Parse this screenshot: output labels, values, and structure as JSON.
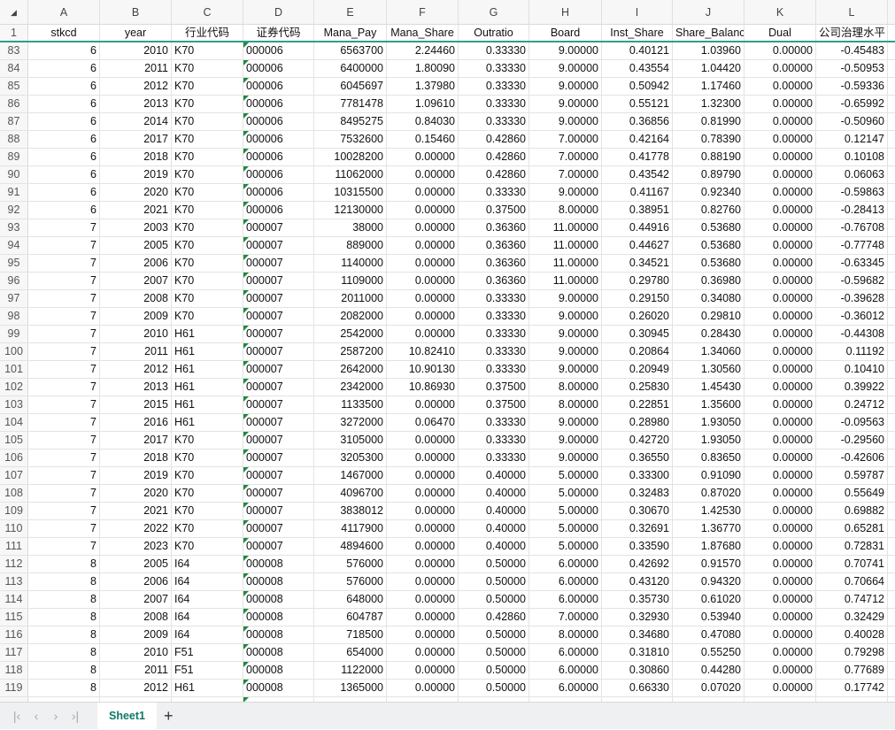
{
  "column_letters": [
    "A",
    "B",
    "C",
    "D",
    "E",
    "F",
    "G",
    "H",
    "I",
    "J",
    "K",
    "L"
  ],
  "corner_icon": "select-all-triangle",
  "header_row_number": "1",
  "headers": [
    "stkcd",
    "year",
    "行业代码",
    "证券代码",
    "Mana_Pay",
    "Mana_Share",
    "Outratio",
    "Board",
    "Inst_Share",
    "Share_Balance",
    "Dual",
    "公司治理水平"
  ],
  "rows": [
    [
      "83",
      "6",
      "2010",
      "K70",
      "000006",
      "6563700",
      "2.24460",
      "0.33330",
      "9.00000",
      "0.40121",
      "1.03960",
      "0.00000",
      "-0.45483"
    ],
    [
      "84",
      "6",
      "2011",
      "K70",
      "000006",
      "6400000",
      "1.80090",
      "0.33330",
      "9.00000",
      "0.43554",
      "1.04420",
      "0.00000",
      "-0.50953"
    ],
    [
      "85",
      "6",
      "2012",
      "K70",
      "000006",
      "6045697",
      "1.37980",
      "0.33330",
      "9.00000",
      "0.50942",
      "1.17460",
      "0.00000",
      "-0.59336"
    ],
    [
      "86",
      "6",
      "2013",
      "K70",
      "000006",
      "7781478",
      "1.09610",
      "0.33330",
      "9.00000",
      "0.55121",
      "1.32300",
      "0.00000",
      "-0.65992"
    ],
    [
      "87",
      "6",
      "2014",
      "K70",
      "000006",
      "8495275",
      "0.84030",
      "0.33330",
      "9.00000",
      "0.36856",
      "0.81990",
      "0.00000",
      "-0.50960"
    ],
    [
      "88",
      "6",
      "2017",
      "K70",
      "000006",
      "7532600",
      "0.15460",
      "0.42860",
      "7.00000",
      "0.42164",
      "0.78390",
      "0.00000",
      "0.12147"
    ],
    [
      "89",
      "6",
      "2018",
      "K70",
      "000006",
      "10028200",
      "0.00000",
      "0.42860",
      "7.00000",
      "0.41778",
      "0.88190",
      "0.00000",
      "0.10108"
    ],
    [
      "90",
      "6",
      "2019",
      "K70",
      "000006",
      "11062000",
      "0.00000",
      "0.42860",
      "7.00000",
      "0.43542",
      "0.89790",
      "0.00000",
      "0.06063"
    ],
    [
      "91",
      "6",
      "2020",
      "K70",
      "000006",
      "10315500",
      "0.00000",
      "0.33330",
      "9.00000",
      "0.41167",
      "0.92340",
      "0.00000",
      "-0.59863"
    ],
    [
      "92",
      "6",
      "2021",
      "K70",
      "000006",
      "12130000",
      "0.00000",
      "0.37500",
      "8.00000",
      "0.38951",
      "0.82760",
      "0.00000",
      "-0.28413"
    ],
    [
      "93",
      "7",
      "2003",
      "K70",
      "000007",
      "38000",
      "0.00000",
      "0.36360",
      "11.00000",
      "0.44916",
      "0.53680",
      "0.00000",
      "-0.76708"
    ],
    [
      "94",
      "7",
      "2005",
      "K70",
      "000007",
      "889000",
      "0.00000",
      "0.36360",
      "11.00000",
      "0.44627",
      "0.53680",
      "0.00000",
      "-0.77748"
    ],
    [
      "95",
      "7",
      "2006",
      "K70",
      "000007",
      "1140000",
      "0.00000",
      "0.36360",
      "11.00000",
      "0.34521",
      "0.53680",
      "0.00000",
      "-0.63345"
    ],
    [
      "96",
      "7",
      "2007",
      "K70",
      "000007",
      "1109000",
      "0.00000",
      "0.36360",
      "11.00000",
      "0.29780",
      "0.36980",
      "0.00000",
      "-0.59682"
    ],
    [
      "97",
      "7",
      "2008",
      "K70",
      "000007",
      "2011000",
      "0.00000",
      "0.33330",
      "9.00000",
      "0.29150",
      "0.34080",
      "0.00000",
      "-0.39628"
    ],
    [
      "98",
      "7",
      "2009",
      "K70",
      "000007",
      "2082000",
      "0.00000",
      "0.33330",
      "9.00000",
      "0.26020",
      "0.29810",
      "0.00000",
      "-0.36012"
    ],
    [
      "99",
      "7",
      "2010",
      "H61",
      "000007",
      "2542000",
      "0.00000",
      "0.33330",
      "9.00000",
      "0.30945",
      "0.28430",
      "0.00000",
      "-0.44308"
    ],
    [
      "100",
      "7",
      "2011",
      "H61",
      "000007",
      "2587200",
      "10.82410",
      "0.33330",
      "9.00000",
      "0.20864",
      "1.34060",
      "0.00000",
      "0.11192"
    ],
    [
      "101",
      "7",
      "2012",
      "H61",
      "000007",
      "2642000",
      "10.90130",
      "0.33330",
      "9.00000",
      "0.20949",
      "1.30560",
      "0.00000",
      "0.10410"
    ],
    [
      "102",
      "7",
      "2013",
      "H61",
      "000007",
      "2342000",
      "10.86930",
      "0.37500",
      "8.00000",
      "0.25830",
      "1.45430",
      "0.00000",
      "0.39922"
    ],
    [
      "103",
      "7",
      "2015",
      "H61",
      "000007",
      "1133500",
      "0.00000",
      "0.37500",
      "8.00000",
      "0.22851",
      "1.35600",
      "0.00000",
      "0.24712"
    ],
    [
      "104",
      "7",
      "2016",
      "H61",
      "000007",
      "3272000",
      "0.06470",
      "0.33330",
      "9.00000",
      "0.28980",
      "1.93050",
      "0.00000",
      "-0.09563"
    ],
    [
      "105",
      "7",
      "2017",
      "K70",
      "000007",
      "3105000",
      "0.00000",
      "0.33330",
      "9.00000",
      "0.42720",
      "1.93050",
      "0.00000",
      "-0.29560"
    ],
    [
      "106",
      "7",
      "2018",
      "K70",
      "000007",
      "3205300",
      "0.00000",
      "0.33330",
      "9.00000",
      "0.36550",
      "0.83650",
      "0.00000",
      "-0.42606"
    ],
    [
      "107",
      "7",
      "2019",
      "K70",
      "000007",
      "1467000",
      "0.00000",
      "0.40000",
      "5.00000",
      "0.33300",
      "0.91090",
      "0.00000",
      "0.59787"
    ],
    [
      "108",
      "7",
      "2020",
      "K70",
      "000007",
      "4096700",
      "0.00000",
      "0.40000",
      "5.00000",
      "0.32483",
      "0.87020",
      "0.00000",
      "0.55649"
    ],
    [
      "109",
      "7",
      "2021",
      "K70",
      "000007",
      "3838012",
      "0.00000",
      "0.40000",
      "5.00000",
      "0.30670",
      "1.42530",
      "0.00000",
      "0.69882"
    ],
    [
      "110",
      "7",
      "2022",
      "K70",
      "000007",
      "4117900",
      "0.00000",
      "0.40000",
      "5.00000",
      "0.32691",
      "1.36770",
      "0.00000",
      "0.65281"
    ],
    [
      "111",
      "7",
      "2023",
      "K70",
      "000007",
      "4894600",
      "0.00000",
      "0.40000",
      "5.00000",
      "0.33590",
      "1.87680",
      "0.00000",
      "0.72831"
    ],
    [
      "112",
      "8",
      "2005",
      "I64",
      "000008",
      "576000",
      "0.00000",
      "0.50000",
      "6.00000",
      "0.42692",
      "0.91570",
      "0.00000",
      "0.70741"
    ],
    [
      "113",
      "8",
      "2006",
      "I64",
      "000008",
      "576000",
      "0.00000",
      "0.50000",
      "6.00000",
      "0.43120",
      "0.94320",
      "0.00000",
      "0.70664"
    ],
    [
      "114",
      "8",
      "2007",
      "I64",
      "000008",
      "648000",
      "0.00000",
      "0.50000",
      "6.00000",
      "0.35730",
      "0.61020",
      "0.00000",
      "0.74712"
    ],
    [
      "115",
      "8",
      "2008",
      "I64",
      "000008",
      "604787",
      "0.00000",
      "0.42860",
      "7.00000",
      "0.32930",
      "0.53940",
      "0.00000",
      "0.32429"
    ],
    [
      "116",
      "8",
      "2009",
      "I64",
      "000008",
      "718500",
      "0.00000",
      "0.50000",
      "8.00000",
      "0.34680",
      "0.47080",
      "0.00000",
      "0.40028"
    ],
    [
      "117",
      "8",
      "2010",
      "F51",
      "000008",
      "654000",
      "0.00000",
      "0.50000",
      "6.00000",
      "0.31810",
      "0.55250",
      "0.00000",
      "0.79298"
    ],
    [
      "118",
      "8",
      "2011",
      "F51",
      "000008",
      "1122000",
      "0.00000",
      "0.50000",
      "6.00000",
      "0.30860",
      "0.44280",
      "0.00000",
      "0.77689"
    ],
    [
      "119",
      "8",
      "2012",
      "H61",
      "000008",
      "1365000",
      "0.00000",
      "0.50000",
      "6.00000",
      "0.66330",
      "0.07020",
      "0.00000",
      "0.17742"
    ]
  ],
  "sheet_tabs": {
    "active": "Sheet1",
    "add_label": "+"
  },
  "nav": {
    "first": "|‹",
    "prev": "‹",
    "next": "›",
    "last": "›|"
  },
  "colors": {
    "accent": "#0d7a66",
    "freeze_line": "#2f9e8a",
    "error_triangle": "#1e8a3a"
  }
}
